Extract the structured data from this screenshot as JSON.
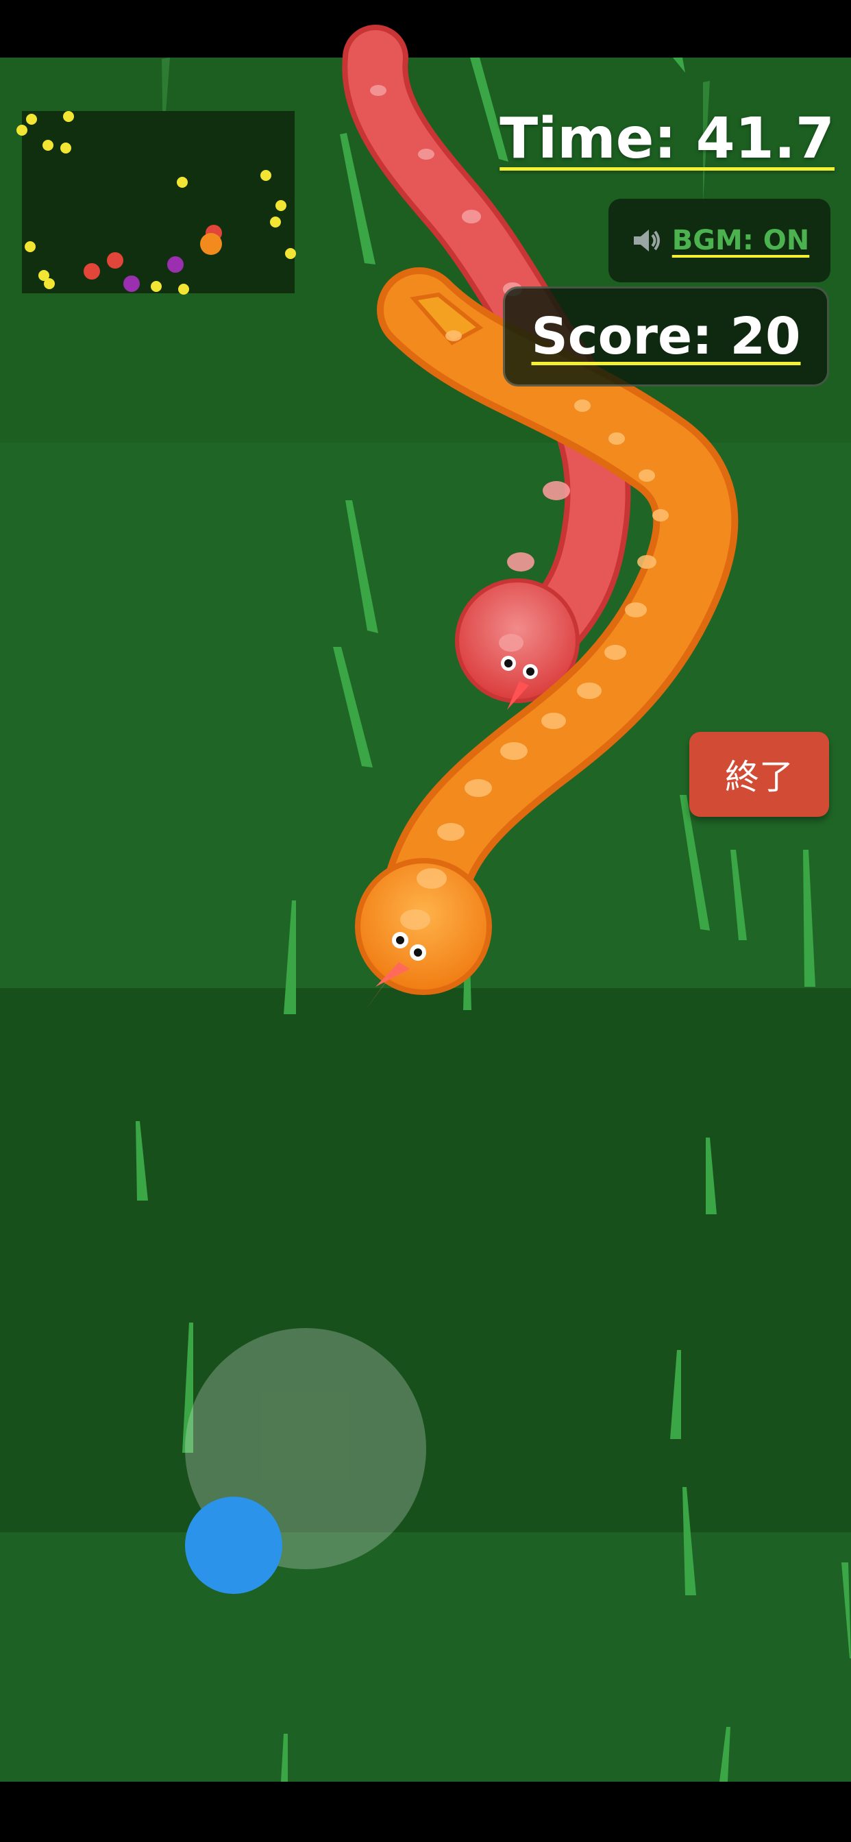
{
  "hud": {
    "time_text": "Time: 41.7",
    "bgm_label": "BGM: ON",
    "score_text": "Score: 20",
    "quit_label": "終了"
  },
  "icons": {
    "bgm": "speaker-icon"
  },
  "colors": {
    "grass_dark": "#1b5a1f",
    "grass_light": "#1e6424",
    "accent_underline": "#f4f132",
    "player_snake": "#f08a1e",
    "enemy_snake": "#e05252",
    "quit_button": "#d24b35",
    "joystick_knob": "#2b93ea"
  }
}
